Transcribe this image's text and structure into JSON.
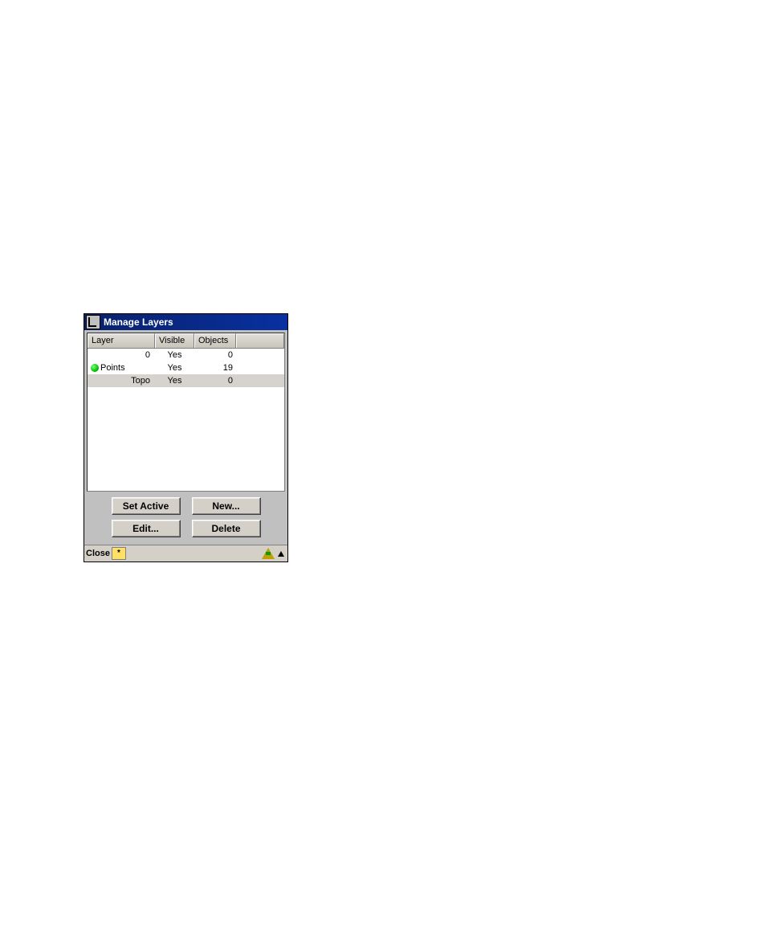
{
  "dialog": {
    "title": "Manage Layers",
    "columns": {
      "layer": "Layer",
      "visible": "Visible",
      "objects": "Objects"
    },
    "rows": [
      {
        "active": false,
        "name": "0",
        "visible": "Yes",
        "objects": "0",
        "selected": false
      },
      {
        "active": true,
        "name": "Points",
        "visible": "Yes",
        "objects": "19",
        "selected": false
      },
      {
        "active": false,
        "name": "Topo",
        "visible": "Yes",
        "objects": "0",
        "selected": true
      }
    ],
    "buttons": {
      "setActive": "Set Active",
      "new": "New...",
      "edit": "Edit...",
      "delete": "Delete"
    },
    "status": {
      "close": "Close",
      "star": "*"
    }
  }
}
